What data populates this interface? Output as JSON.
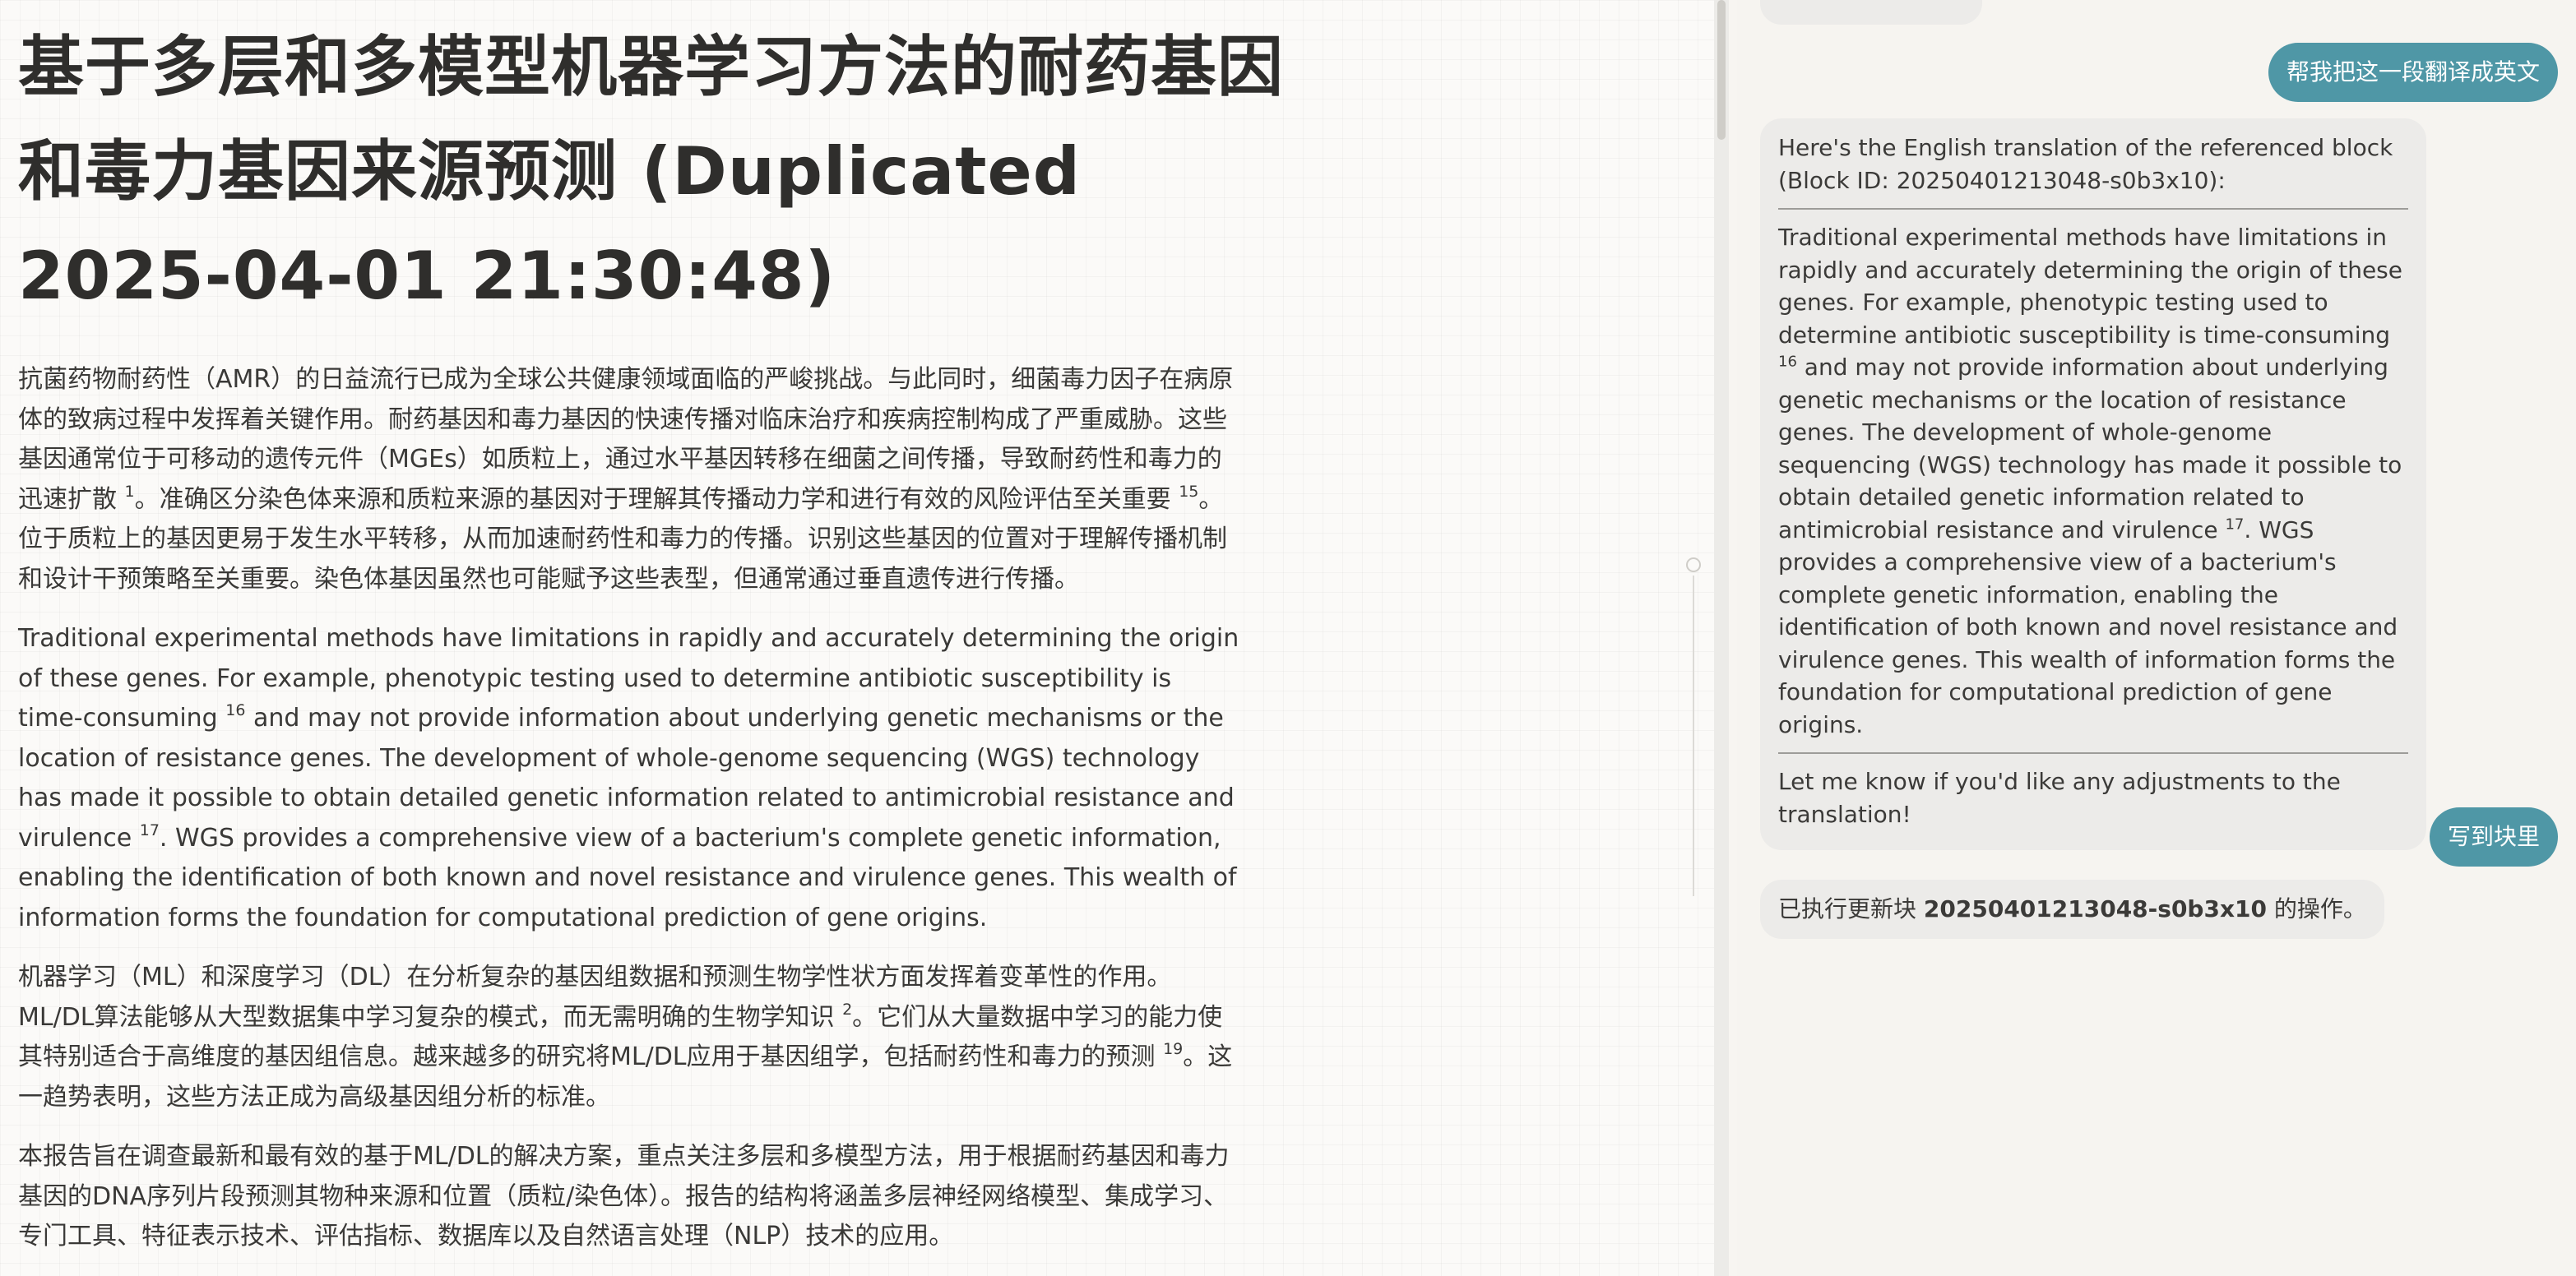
{
  "document": {
    "title": "基于多层和多模型机器学习方法的耐药基因和毒力基因来源预测 (Duplicated 2025-04-01 21:30:48)",
    "paragraphs": [
      {
        "parts": [
          {
            "text": "抗菌药物耐药性（AMR）的日益流行已成为全球公共健康领域面临的严峻挑战。与此同时，细菌毒力因子在病原体的致病过程中发挥着关键作用。耐药基因和毒力基因的快速传播对临床治疗和疾病控制构成了严重威胁。这些基因通常位于可移动的遗传元件（MGEs）如质粒上，通过水平基因转移在细菌之间传播，导致耐药性和毒力的迅速扩散 "
          },
          {
            "sup": "1"
          },
          {
            "text": "。准确区分染色体来源和质粒来源的基因对于理解其传播动力学和进行有效的风险评估至关重要 "
          },
          {
            "sup": "15"
          },
          {
            "text": "。位于质粒上的基因更易于发生水平转移，从而加速耐药性和毒力的传播。识别这些基因的位置对于理解传播机制和设计干预策略至关重要。染色体基因虽然也可能赋予这些表型，但通常通过垂直遗传进行传播。"
          }
        ]
      },
      {
        "parts": [
          {
            "text": "Traditional experimental methods have limitations in rapidly and accurately determining the origin of these genes. For example, phenotypic testing used to determine antibiotic susceptibility is time-consuming "
          },
          {
            "sup": "16"
          },
          {
            "text": " and may not provide information about underlying genetic mechanisms or the location of resistance genes. The development of whole-genome sequencing (WGS) technology has made it possible to obtain detailed genetic information related to antimicrobial resistance and virulence "
          },
          {
            "sup": "17"
          },
          {
            "text": ". WGS provides a comprehensive view of a bacterium's complete genetic information, enabling the identification of both known and novel resistance and virulence genes. This wealth of information forms the foundation for computational prediction of gene origins."
          }
        ]
      },
      {
        "parts": [
          {
            "text": "机器学习（ML）和深度学习（DL）在分析复杂的基因组数据和预测生物学性状方面发挥着变革性的作用。ML/DL算法能够从大型数据集中学习复杂的模式，而无需明确的生物学知识 "
          },
          {
            "sup": "2"
          },
          {
            "text": "。它们从大量数据中学习的能力使其特别适合于高维度的基因组信息。越来越多的研究将ML/DL应用于基因组学，包括耐药性和毒力的预测 "
          },
          {
            "sup": "19"
          },
          {
            "text": "。这一趋势表明，这些方法正成为高级基因组分析的标准。"
          }
        ]
      },
      {
        "parts": [
          {
            "text": "本报告旨在调查最新和最有效的基于ML/DL的解决方案，重点关注多层和多模型方法，用于根据耐药基因和毒力基因的DNA序列片段预测其物种来源和位置（质粒/染色体）。报告的结构将涵盖多层神经网络模型、集成学习、专门工具、特征表示技术、评估指标、数据库以及自然语言处理（NLP）技术的应用。"
          }
        ]
      }
    ]
  },
  "chat": {
    "user_msg_1": "帮我把这一段翻译成英文",
    "ai_reply_1": {
      "intro": "Here's the English translation of the referenced block (Block ID: 20250401213048-s0b3x10):",
      "translation_parts": [
        {
          "text": "Traditional experimental methods have limitations in rapidly and accurately determining the origin of these genes. For example, phenotypic testing used to determine antibiotic susceptibility is time-consuming "
        },
        {
          "sup": "16"
        },
        {
          "text": " and may not provide information about underlying genetic mechanisms or the location of resistance genes. The development of whole-genome sequencing (WGS) technology has made it possible to obtain detailed genetic information related to antimicrobial resistance and virulence "
        },
        {
          "sup": "17"
        },
        {
          "text": ". WGS provides a comprehensive view of a bacterium's complete genetic information, enabling the identification of both known and novel resistance and virulence genes. This wealth of information forms the foundation for computational prediction of gene origins."
        }
      ],
      "outro": "Let me know if you'd like any adjustments to the translation!"
    },
    "user_msg_2": "写到块里",
    "ai_reply_2": {
      "prefix": "已执行更新块 ",
      "block_id": "20250401213048-s0b3x10",
      "suffix": " 的操作。"
    }
  }
}
